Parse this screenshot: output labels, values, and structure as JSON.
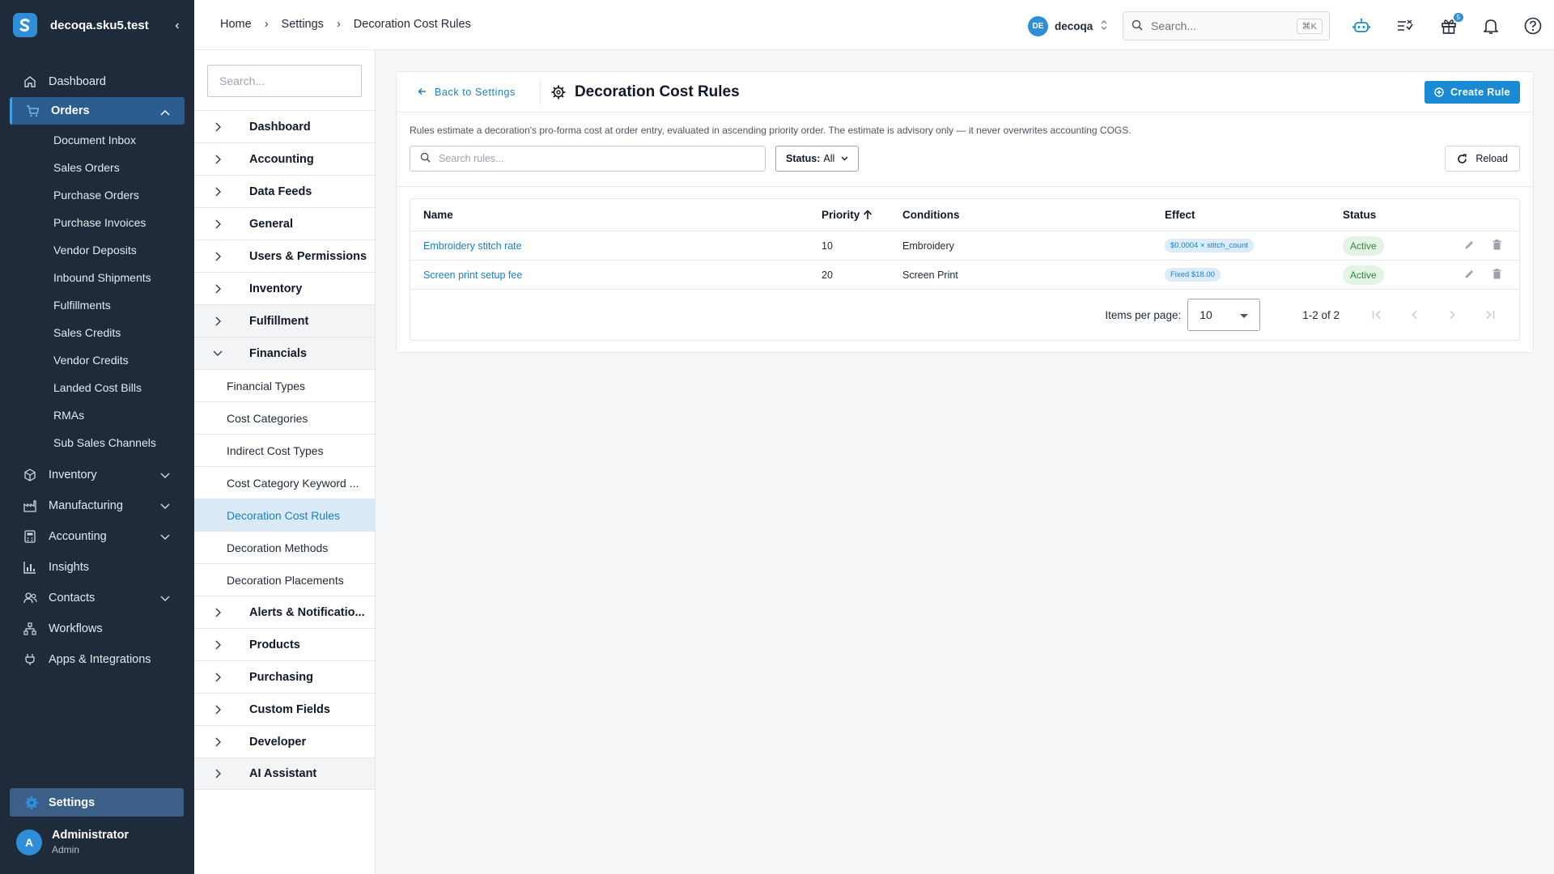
{
  "app": {
    "workspace": "decoqa.sku5.test",
    "collapse_icon": "chevron-left-icon"
  },
  "colors": {
    "sidebar_bg": "#1f2a3a",
    "accent": "#1a8ad4",
    "active_nav": "#2b5d8e",
    "status_active": "#2e8b3a",
    "selected_row": "#dbeaf7"
  },
  "sidebar": {
    "items": [
      {
        "label": "Dashboard",
        "icon": "home-icon"
      },
      {
        "label": "Orders",
        "icon": "cart-icon",
        "expanded": true
      },
      {
        "label": "Inventory",
        "icon": "box-icon"
      },
      {
        "label": "Manufacturing",
        "icon": "factory-icon"
      },
      {
        "label": "Accounting",
        "icon": "calculator-icon"
      },
      {
        "label": "Insights",
        "icon": "bar-chart-icon"
      },
      {
        "label": "Contacts",
        "icon": "people-icon"
      },
      {
        "label": "Workflows",
        "icon": "workflow-icon"
      },
      {
        "label": "Apps & Integrations",
        "icon": "plug-icon"
      }
    ],
    "orders_sub": [
      "Document Inbox",
      "Sales Orders",
      "Purchase Orders",
      "Purchase Invoices",
      "Vendor Deposits",
      "Inbound Shipments",
      "Fulfillments",
      "Sales Credits",
      "Vendor Credits",
      "Landed Cost Bills",
      "RMAs",
      "Sub Sales Channels"
    ],
    "settings_label": "Settings",
    "user": {
      "initial": "A",
      "name": "Administrator",
      "role": "Admin"
    }
  },
  "topbar": {
    "breadcrumbs": [
      "Home",
      "Settings",
      "Decoration Cost Rules"
    ],
    "org_initials": "DE",
    "org_name": "decoqa",
    "search_placeholder": "Search...",
    "search_shortcut": "⌘K",
    "gift_count": "5"
  },
  "settings_panel": {
    "search_placeholder": "Search...",
    "groups_before": [
      "Dashboard",
      "Accounting",
      "Data Feeds",
      "General",
      "Users & Permissions",
      "Inventory",
      "Fulfillment"
    ],
    "open_group": "Financials",
    "open_items": [
      "Financial Types",
      "Cost Categories",
      "Indirect Cost Types",
      "Cost Category Keyword ...",
      "Decoration Cost Rules",
      "Decoration Methods",
      "Decoration Placements"
    ],
    "selected_item": "Decoration Cost Rules",
    "groups_after": [
      "Alerts & Notificatio...",
      "Products",
      "Purchasing",
      "Custom Fields",
      "Developer",
      "AI Assistant"
    ]
  },
  "page": {
    "back_label": "Back to Settings",
    "title": "Decoration Cost Rules",
    "create_label": "Create Rule",
    "description": "Rules estimate a decoration's pro-forma cost at order entry, evaluated in ascending priority order. The estimate is advisory only — it never overwrites accounting COGS.",
    "search_placeholder": "Search rules...",
    "status_filter_label": "Status:",
    "status_filter_value": "All",
    "reload_label": "Reload"
  },
  "table": {
    "columns": {
      "name": "Name",
      "priority": "Priority",
      "conditions": "Conditions",
      "effect": "Effect",
      "status": "Status"
    },
    "rows": [
      {
        "name": "Embroidery stitch rate",
        "priority": "10",
        "conditions": "Embroidery",
        "effect": "$0.0004 × stitch_count",
        "status": "Active"
      },
      {
        "name": "Screen print setup fee",
        "priority": "20",
        "conditions": "Screen Print",
        "effect": "Fixed $18.00",
        "status": "Active"
      }
    ]
  },
  "pagination": {
    "items_per_page_label": "Items per page:",
    "items_per_page": "10",
    "range": "1-2 of 2"
  }
}
